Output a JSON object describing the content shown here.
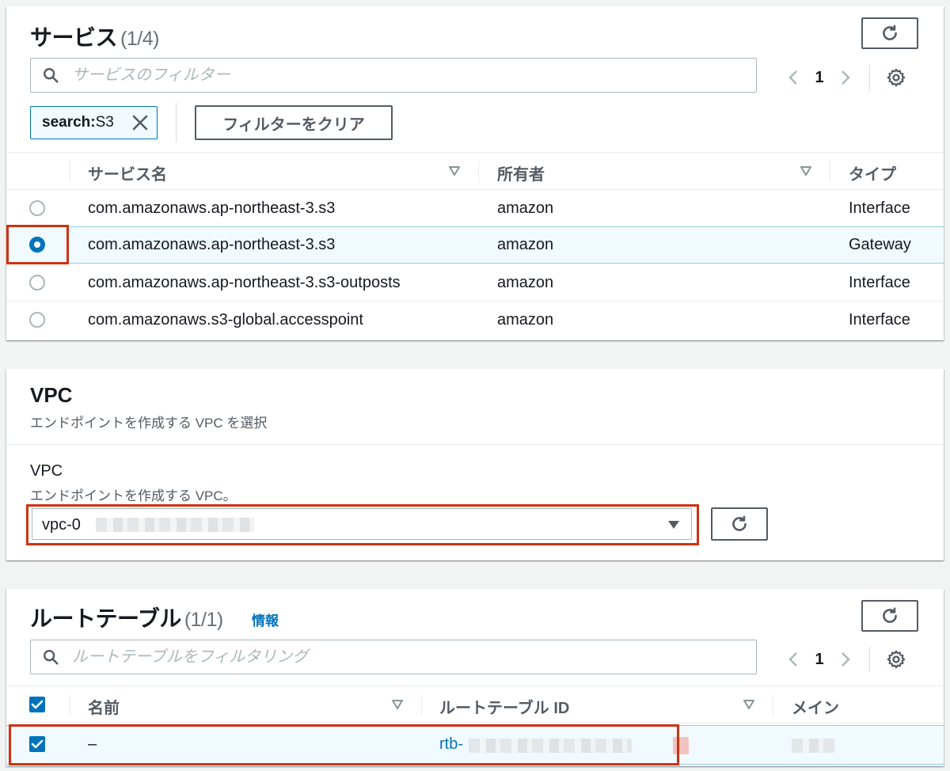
{
  "services": {
    "title": "サービス",
    "count": "(1/4)",
    "search_placeholder": "サービスのフィルター",
    "page": "1",
    "token_key": "search:",
    "token_value": " S3",
    "clear_filters_label": "フィルターをクリア",
    "columns": [
      "サービス名",
      "所有者",
      "タイプ"
    ],
    "rows": [
      {
        "name": "com.amazonaws.ap-northeast-3.s3",
        "owner": "amazon",
        "type": "Interface",
        "selected": false
      },
      {
        "name": "com.amazonaws.ap-northeast-3.s3",
        "owner": "amazon",
        "type": "Gateway",
        "selected": true
      },
      {
        "name": "com.amazonaws.ap-northeast-3.s3-outposts",
        "owner": "amazon",
        "type": "Interface",
        "selected": false
      },
      {
        "name": "com.amazonaws.s3-global.accesspoint",
        "owner": "amazon",
        "type": "Interface",
        "selected": false
      }
    ]
  },
  "vpc": {
    "title": "VPC",
    "description": "エンドポイントを作成する VPC を選択",
    "field_label": "VPC",
    "field_description": "エンドポイントを作成する VPC。",
    "selected_value": "vpc-0"
  },
  "route_tables": {
    "title": "ルートテーブル",
    "count": "(1/1)",
    "info_label": "情報",
    "search_placeholder": "ルートテーブルをフィルタリング",
    "page": "1",
    "columns": [
      "名前",
      "ルートテーブル ID",
      "メイン"
    ],
    "rows": [
      {
        "name": "–",
        "route_table_id": "rtb-",
        "checked": true
      }
    ]
  },
  "colors": {
    "accent": "#0073bb",
    "highlight": "#d13212",
    "background": "#f2f3f3"
  },
  "icons": [
    "search-icon",
    "refresh-icon",
    "chevron-left-icon",
    "chevron-right-icon",
    "gear-icon",
    "close-icon",
    "sort-caret-icon",
    "dropdown-caret-icon",
    "checkbox-icon"
  ]
}
